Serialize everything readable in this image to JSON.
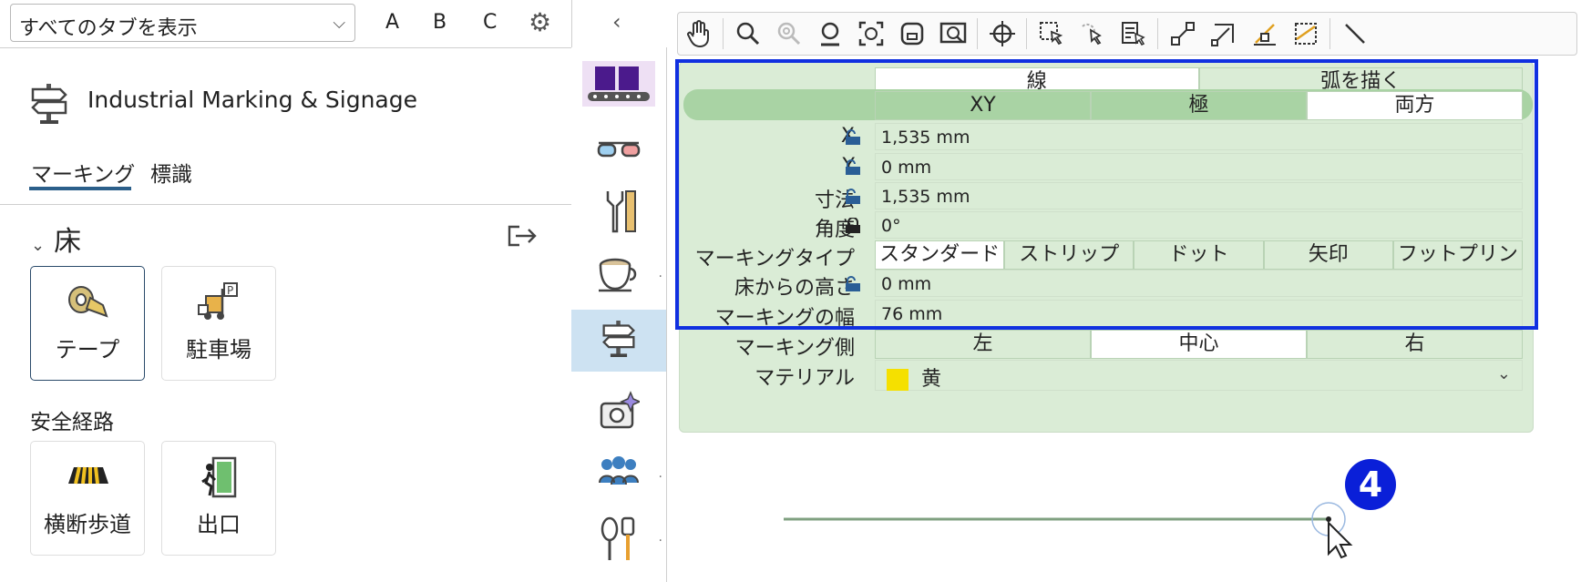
{
  "left_panel": {
    "filter_select": "すべてのタブを表示",
    "letters": [
      "A",
      "B",
      "C"
    ],
    "catalog_title": "Industrial Marking & Signage",
    "tabs": [
      "マーキング",
      "標識"
    ],
    "section_title": "床",
    "tiles": [
      {
        "label": "テープ",
        "icon": "tape-icon"
      },
      {
        "label": "駐車場",
        "icon": "forklift-parking-icon"
      },
      {
        "label": "横断歩道",
        "icon": "crosswalk-icon"
      },
      {
        "label": "出口",
        "icon": "exit-icon"
      }
    ],
    "group_title": "安全経路"
  },
  "properties": {
    "line_modes": [
      "線",
      "弧を描く"
    ],
    "coord_modes": [
      "XY",
      "極",
      "両方"
    ],
    "x_label": "X",
    "x_value": "1,535 mm",
    "y_label": "Y",
    "y_value": "0 mm",
    "dim_label": "寸法",
    "dim_value": "1,535 mm",
    "angle_label": "角度",
    "angle_value": "0°",
    "marking_type_label": "マーキングタイプ",
    "marking_types": [
      "スタンダード",
      "ストリップ",
      "ドット",
      "矢印",
      "フットプリント"
    ],
    "height_label": "床からの高さ",
    "height_value": "0 mm",
    "width_label": "マーキングの幅",
    "width_value": "76 mm",
    "side_label": "マーキング側",
    "sides": [
      "左",
      "中心",
      "右"
    ],
    "material_label": "マテリアル",
    "material_value": "黄",
    "material_color": "#f5e000"
  },
  "callout_number": "4",
  "colors": {
    "accent": "#0a1fd8",
    "panel": "#daecd6",
    "line": "#7fa080",
    "selection": "#cde2f2"
  }
}
